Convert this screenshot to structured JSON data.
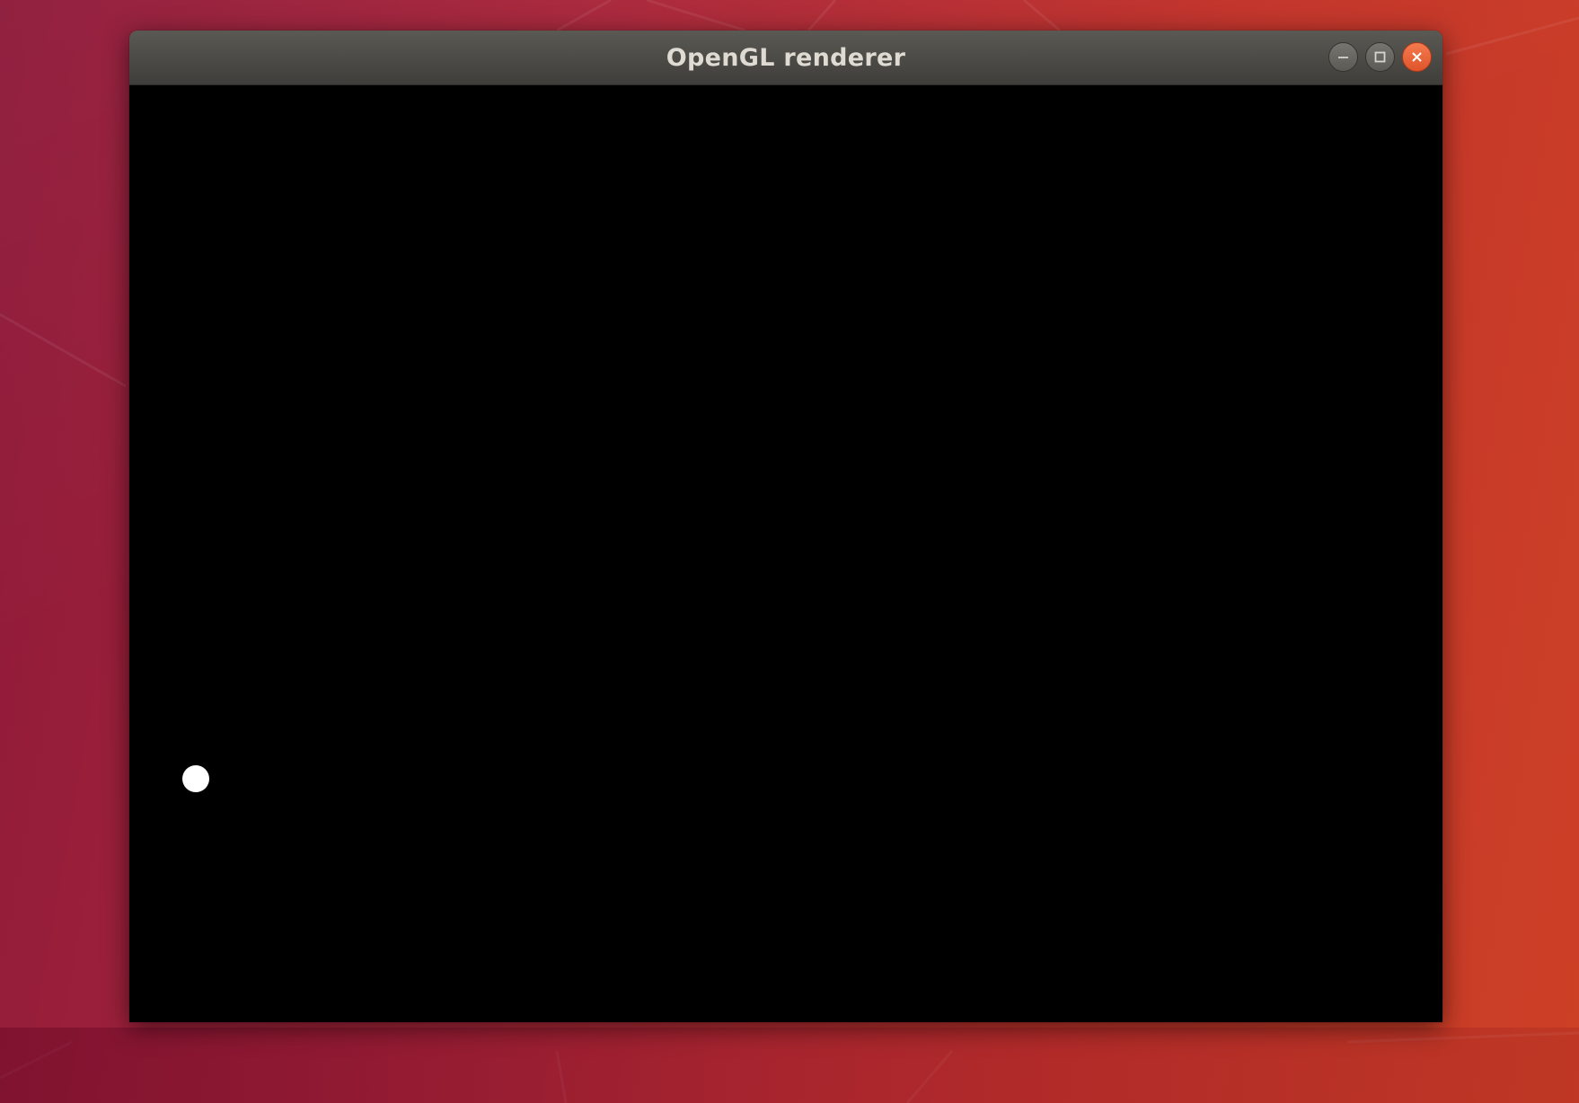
{
  "window": {
    "title": "OpenGL renderer",
    "controls": {
      "minimize_icon": "minimize-icon",
      "maximize_icon": "maximize-icon",
      "close_icon": "close-icon"
    }
  },
  "canvas": {
    "background": "#000000",
    "point_color": "#ffffff"
  },
  "desktop": {
    "wallpaper_colors": [
      "#8e1a3a",
      "#a9263a",
      "#c2342b",
      "#cd4026"
    ]
  }
}
